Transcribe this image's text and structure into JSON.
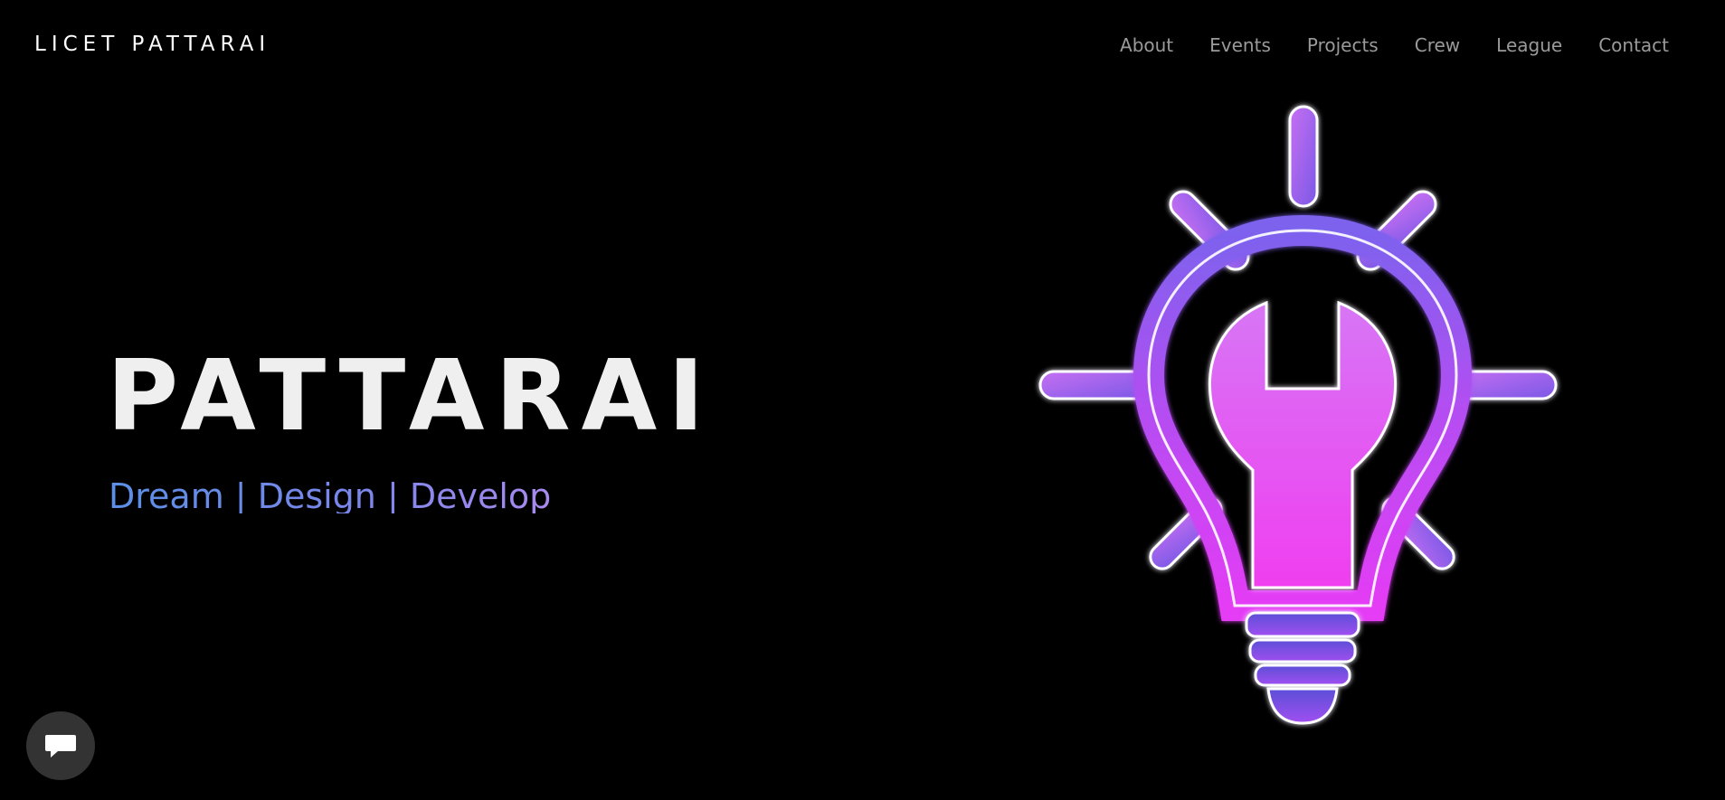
{
  "header": {
    "brand": "LICET PATTARAI",
    "nav": [
      "About",
      "Events",
      "Projects",
      "Crew",
      "League",
      "Contact"
    ]
  },
  "hero": {
    "title": "PATTARAI",
    "tagline": "Dream | Design | Develop"
  },
  "illustration": {
    "icon": "lightbulb-wrench-icon",
    "colors": {
      "magenta": "#e43cf5",
      "violet": "#6a5ce8",
      "glow": "#ffffff"
    }
  },
  "chat": {
    "icon": "chat-bubble-icon"
  }
}
